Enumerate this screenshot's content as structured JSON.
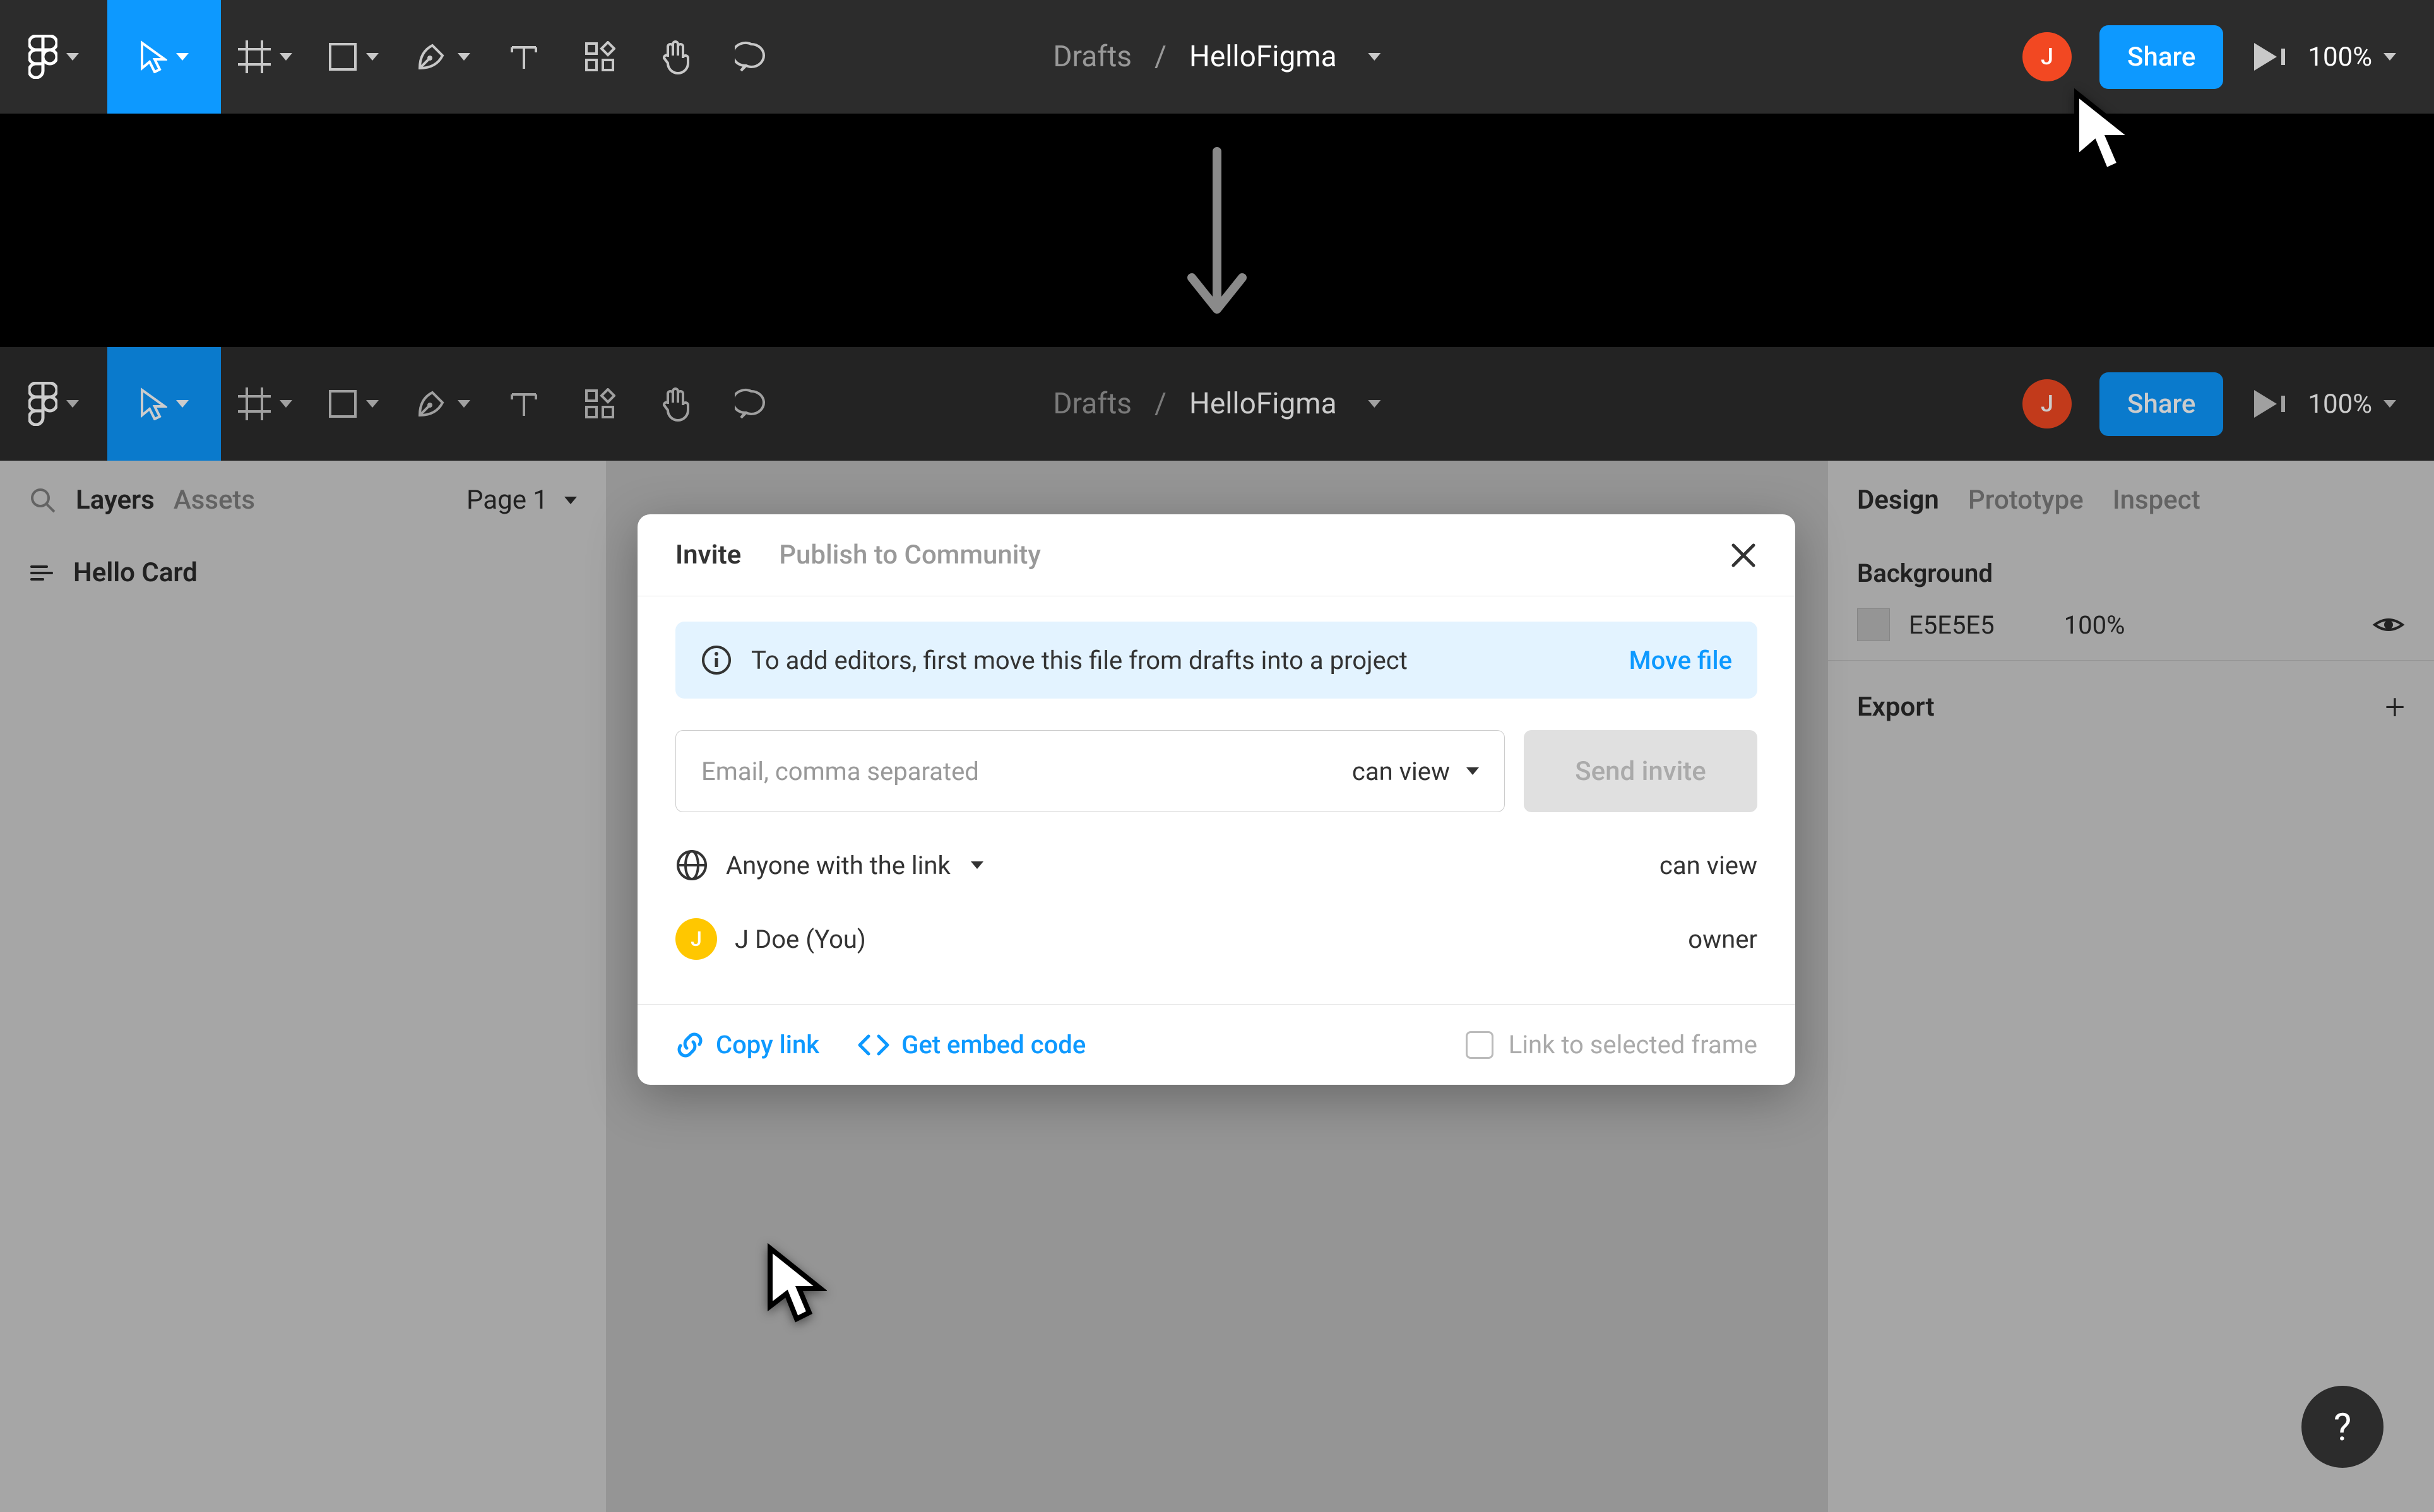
{
  "toolbar": {
    "breadcrumb_parent": "Drafts",
    "breadcrumb_sep": "/",
    "file_name": "HelloFigma",
    "avatar_initial": "J",
    "share_label": "Share",
    "zoom_label": "100%"
  },
  "left_sidebar": {
    "tab_layers": "Layers",
    "tab_assets": "Assets",
    "page_label": "Page 1",
    "layer_name": "Hello Card"
  },
  "right_sidebar": {
    "tab_design": "Design",
    "tab_prototype": "Prototype",
    "tab_inspect": "Inspect",
    "bg_section": "Background",
    "bg_hex": "E5E5E5",
    "bg_opacity": "100%",
    "export_section": "Export"
  },
  "modal": {
    "tab_invite": "Invite",
    "tab_publish": "Publish to Community",
    "banner_text": "To add editors, first move this file from drafts into a project",
    "banner_action": "Move file",
    "email_placeholder": "Email, comma separated",
    "email_permission": "can view",
    "send_label": "Send invite",
    "link_scope": "Anyone with the link",
    "link_permission": "can view",
    "user_avatar_initial": "J",
    "user_label": "J Doe (You)",
    "user_role": "owner",
    "copy_link": "Copy link",
    "embed": "Get embed code",
    "frame_check": "Link to selected frame"
  },
  "fab": "?"
}
